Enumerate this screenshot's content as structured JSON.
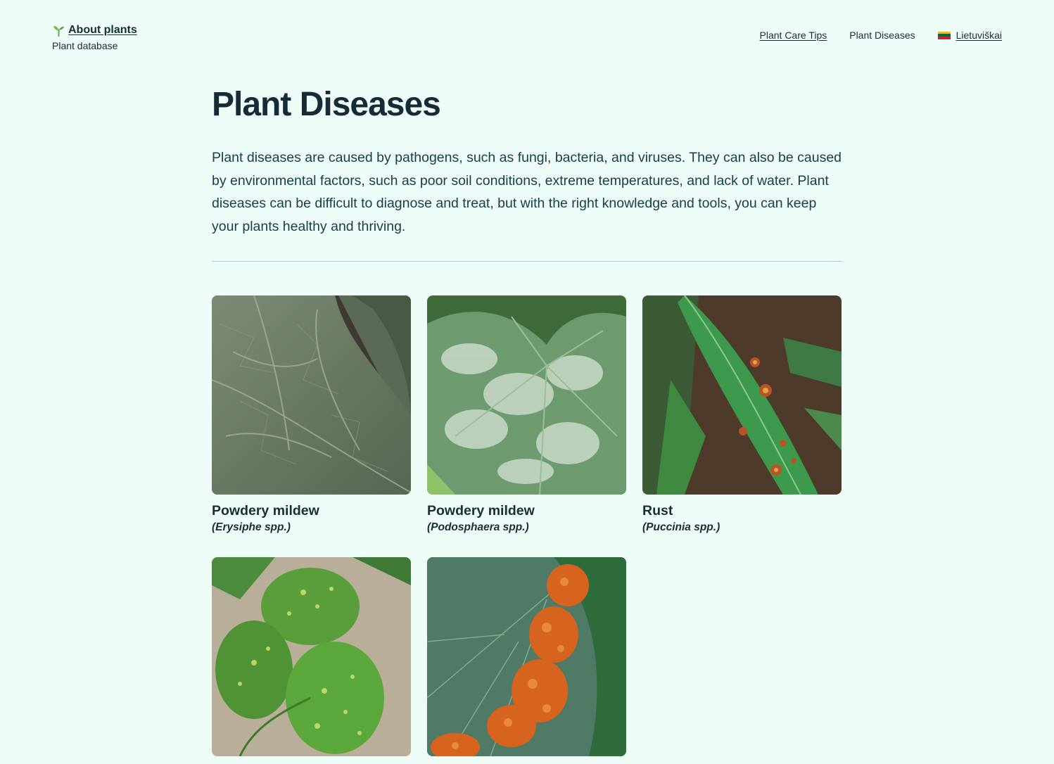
{
  "site": {
    "name": "About plants",
    "tagline": "Plant database",
    "logo_icon": "sprout-icon"
  },
  "nav": {
    "items": [
      {
        "label": "Plant Care Tips"
      },
      {
        "label": "Plant Diseases"
      },
      {
        "label": "Lietuviškai",
        "icon": "lithuania-flag-icon"
      }
    ]
  },
  "colors": {
    "background": "#effdf8",
    "text": "#1a2e35",
    "divider": "#9fd3df",
    "accent_green": "#5aa83c"
  },
  "main": {
    "title": "Plant Diseases",
    "intro": "Plant diseases are caused by pathogens, such as fungi, bacteria, and viruses. They can also be caused by environmental factors, such as poor soil conditions, extreme temperatures, and lack of water. Plant diseases can be difficult to diagnose and treat, but with the right knowledge and tools, you can keep your plants healthy and thriving.",
    "diseases": [
      {
        "name": "Powdery mildew",
        "scientific": "(Erysiphe spp.)",
        "image": "grey-green textured leaf with mildew coating"
      },
      {
        "name": "Powdery mildew",
        "scientific": "(Podosphaera spp.)",
        "image": "green leaf with white powdery patches"
      },
      {
        "name": "Rust",
        "scientific": "(Puccinia spp.)",
        "image": "long green leaf with orange rust spots"
      },
      {
        "name": "",
        "scientific": "",
        "image": "bean leaves with yellow-green mottling"
      },
      {
        "name": "",
        "scientific": "",
        "image": "leaf underside with orange rust pustules"
      }
    ]
  }
}
